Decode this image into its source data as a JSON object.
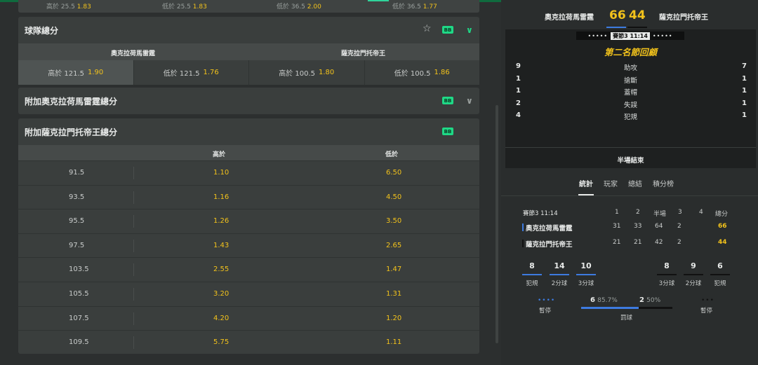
{
  "top_strip": {
    "a_label": "高於 25.5",
    "a_odd": "1.83",
    "b_label": "低於 25.5",
    "b_odd": "1.83",
    "c_label": "低於 36.5",
    "c_odd": "2.00",
    "d_label": "低於 36.5",
    "d_odd": "1.77"
  },
  "team_totals": {
    "title": "球隊總分",
    "badge": "BB",
    "home_team": "奧克拉荷馬雷霆",
    "away_team": "薩克拉門托帝王",
    "bets": [
      {
        "label": "高於 121.5",
        "odd": "1.90"
      },
      {
        "label": "低於 121.5",
        "odd": "1.76"
      },
      {
        "label": "高於 100.5",
        "odd": "1.80"
      },
      {
        "label": "低於 100.5",
        "odd": "1.86"
      }
    ]
  },
  "extra_home": {
    "title": "附加奧克拉荷馬雷霆總分",
    "badge": "BB"
  },
  "extra_away": {
    "title": "附加薩克拉門托帝王總分",
    "badge": "BB",
    "over_header": "高於",
    "under_header": "低於",
    "rows": [
      {
        "line": "91.5",
        "over": "1.10",
        "under": "6.50"
      },
      {
        "line": "93.5",
        "over": "1.16",
        "under": "4.50"
      },
      {
        "line": "95.5",
        "over": "1.26",
        "under": "3.50"
      },
      {
        "line": "97.5",
        "over": "1.43",
        "under": "2.65"
      },
      {
        "line": "103.5",
        "over": "2.55",
        "under": "1.47"
      },
      {
        "line": "105.5",
        "over": "3.20",
        "under": "1.31"
      },
      {
        "line": "107.5",
        "over": "4.20",
        "under": "1.20"
      },
      {
        "line": "109.5",
        "over": "5.75",
        "under": "1.11"
      }
    ]
  },
  "scoreboard": {
    "home_team": "奧克拉荷馬雷霆",
    "away_team": "薩克拉門托帝王",
    "home_score": "66",
    "away_score": "44",
    "home_color": "#3d7be0",
    "away_color": "#111111",
    "period": "賽節3",
    "clock": "11:14",
    "recap_title": "第二名節回顧",
    "recap": [
      {
        "home": "9",
        "name": "助攻",
        "away": "7"
      },
      {
        "home": "1",
        "name": "搶斷",
        "away": "1"
      },
      {
        "home": "1",
        "name": "蓋帽",
        "away": "1"
      },
      {
        "home": "2",
        "name": "失誤",
        "away": "1"
      },
      {
        "home": "4",
        "name": "犯規",
        "away": "1"
      }
    ],
    "halftime": "半場結束"
  },
  "tabs": [
    "統計",
    "玩家",
    "總結",
    "積分榜"
  ],
  "box": {
    "period_label": "賽節3  11:14",
    "cols": [
      "1",
      "2",
      "半場",
      "3",
      "4",
      "總分"
    ],
    "home": {
      "name": "奧克拉荷馬雷霆",
      "q1": "31",
      "q2": "33",
      "half": "64",
      "q3": "2",
      "q4": "",
      "total": "66"
    },
    "away": {
      "name": "薩克拉門托帝王",
      "q1": "21",
      "q2": "21",
      "half": "42",
      "q3": "2",
      "q4": "",
      "total": "44"
    }
  },
  "team_stats": {
    "home": [
      {
        "value": "8",
        "label": "犯規"
      },
      {
        "value": "14",
        "label": "2分球"
      },
      {
        "value": "10",
        "label": "3分球"
      }
    ],
    "away": [
      {
        "value": "8",
        "label": "3分球"
      },
      {
        "value": "9",
        "label": "2分球"
      },
      {
        "value": "6",
        "label": "犯規"
      }
    ],
    "home_timeout_label": "暫停",
    "away_timeout_label": "暫停",
    "home_ft": "6",
    "home_ft_pct": "85.7%",
    "away_ft": "2",
    "away_ft_pct": "50%",
    "ft_label": "罰球",
    "home_ft_fraction": 0.63
  }
}
